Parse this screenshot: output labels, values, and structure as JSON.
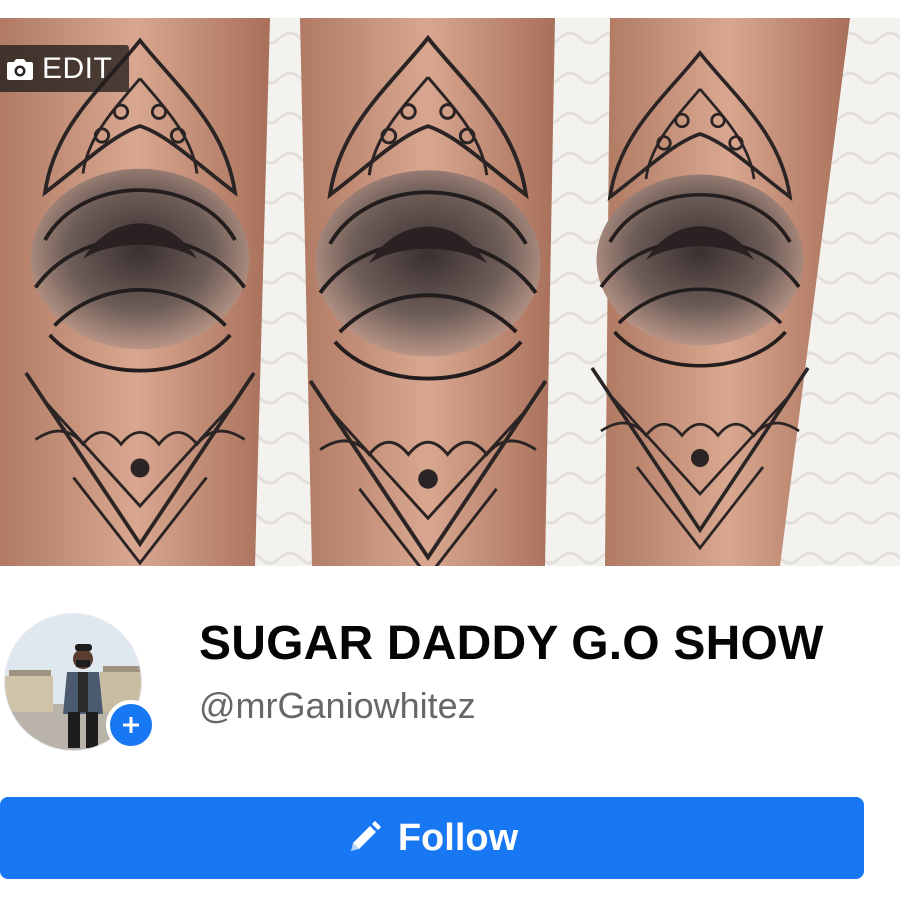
{
  "cover": {
    "edit_label": "EDIT",
    "edit_icon": "camera-icon",
    "image_description_icon": "tattoo-cover-photo"
  },
  "profile": {
    "name": "SUGAR DADDY G.O SHOW",
    "handle": "@mrGaniowhitez",
    "add_photo_icon": "plus-icon"
  },
  "actions": {
    "follow_label": "Follow",
    "follow_icon": "pencil-icon"
  },
  "colors": {
    "accent": "#1877f2",
    "name_text": "#050505",
    "secondary_text": "#65676b"
  }
}
